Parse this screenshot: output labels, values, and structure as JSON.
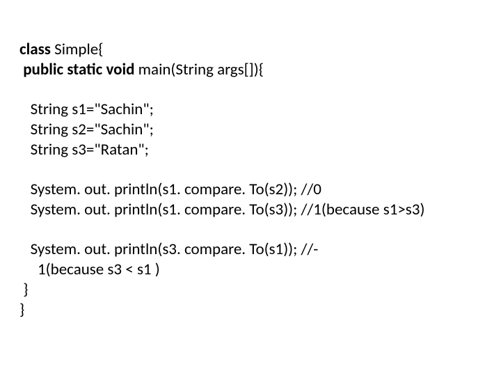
{
  "code": {
    "line1a": "class",
    "line1b": " Simple{  ",
    "line2a": " public static void",
    "line2b": " main(String args[]){  ",
    "blank1": "  ",
    "line3": "   String s1=\"Sachin\";  ",
    "line4": "   String s2=\"Sachin\";  ",
    "line5": "   String s3=\"Ratan\";  ",
    "blank2": "  ",
    "line6": "   System. out. println(s1. compare. To(s2)); //0  ",
    "line7": "   System. out. println(s1. compare. To(s3)); //1(because s1>s3)  ",
    "blank3": "",
    "line8a": "   System. out. println(s3. compare. To(s1)); //-",
    "line8b": "     1(because s3 < s1 )  ",
    "line9": " }  ",
    "line10": "}  "
  }
}
